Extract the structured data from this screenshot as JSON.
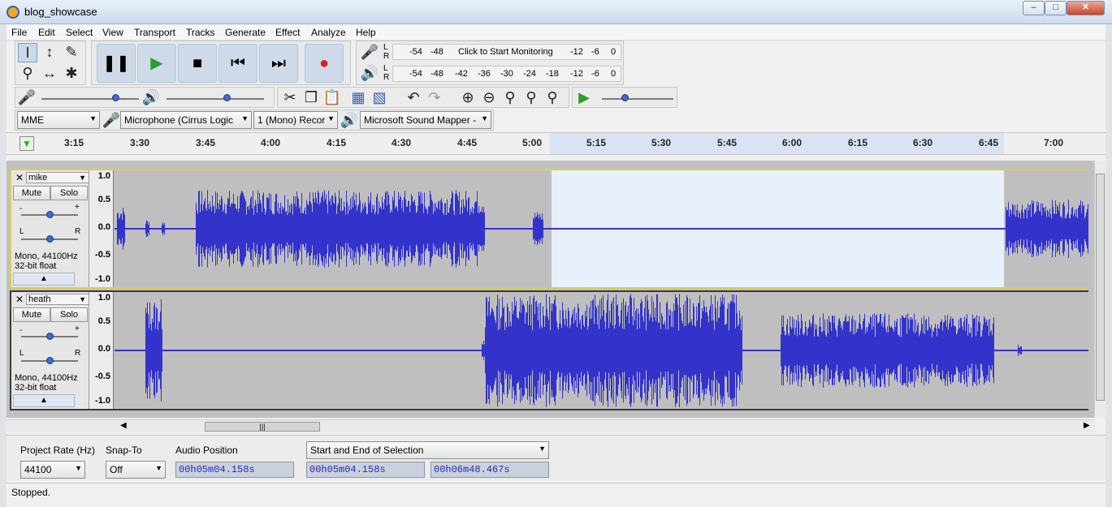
{
  "window": {
    "title": "blog_showcase"
  },
  "menu": [
    "File",
    "Edit",
    "Select",
    "View",
    "Transport",
    "Tracks",
    "Generate",
    "Effect",
    "Analyze",
    "Help"
  ],
  "meters": {
    "record": {
      "L": "L",
      "R": "R",
      "labels": [
        "-54",
        "-48",
        "Click to Start Monitoring",
        "-12",
        "-6",
        "0"
      ]
    },
    "playback": {
      "L": "L",
      "R": "R",
      "labels": [
        "-54",
        "-48",
        "-42",
        "-36",
        "-30",
        "-24",
        "-18",
        "-12",
        "-6",
        "0"
      ]
    }
  },
  "device": {
    "host": "MME",
    "input": "Microphone (Cirrus Logic",
    "channels": "1 (Mono) Recor",
    "output": "Microsoft Sound Mapper -"
  },
  "timeline": {
    "ticks": [
      "3:15",
      "3:30",
      "3:45",
      "4:00",
      "4:15",
      "4:30",
      "4:45",
      "5:00",
      "5:15",
      "5:30",
      "5:45",
      "6:00",
      "6:15",
      "6:30",
      "6:45",
      "7:00"
    ]
  },
  "tracks": [
    {
      "name": "mike",
      "mute": "Mute",
      "solo": "Solo",
      "gain_minus": "-",
      "gain_plus": "+",
      "pan_l": "L",
      "pan_r": "R",
      "info1": "Mono, 44100Hz",
      "info2": "32-bit float",
      "ruler": [
        "1.0",
        "0.5",
        "0.0",
        "-0.5",
        "-1.0"
      ]
    },
    {
      "name": "heath",
      "mute": "Mute",
      "solo": "Solo",
      "gain_minus": "-",
      "gain_plus": "+",
      "pan_l": "L",
      "pan_r": "R",
      "info1": "Mono, 44100Hz",
      "info2": "32-bit float",
      "ruler": [
        "1.0",
        "0.5",
        "0.0",
        "-0.5",
        "-1.0"
      ]
    }
  ],
  "selection_bar": {
    "project_rate_label": "Project Rate (Hz)",
    "project_rate_value": "44100",
    "snap_label": "Snap-To",
    "snap_value": "Off",
    "audio_position_label": "Audio Position",
    "audio_position": "00h05m04.158s",
    "selection_mode": "Start and End of Selection",
    "selection_start": "00h05m04.158s",
    "selection_end": "00h06m48.467s"
  },
  "status": "Stopped.",
  "colors": {
    "wave": "#3333cc",
    "selection": "#e8f0fc",
    "focus_border": "#d9d04e"
  }
}
